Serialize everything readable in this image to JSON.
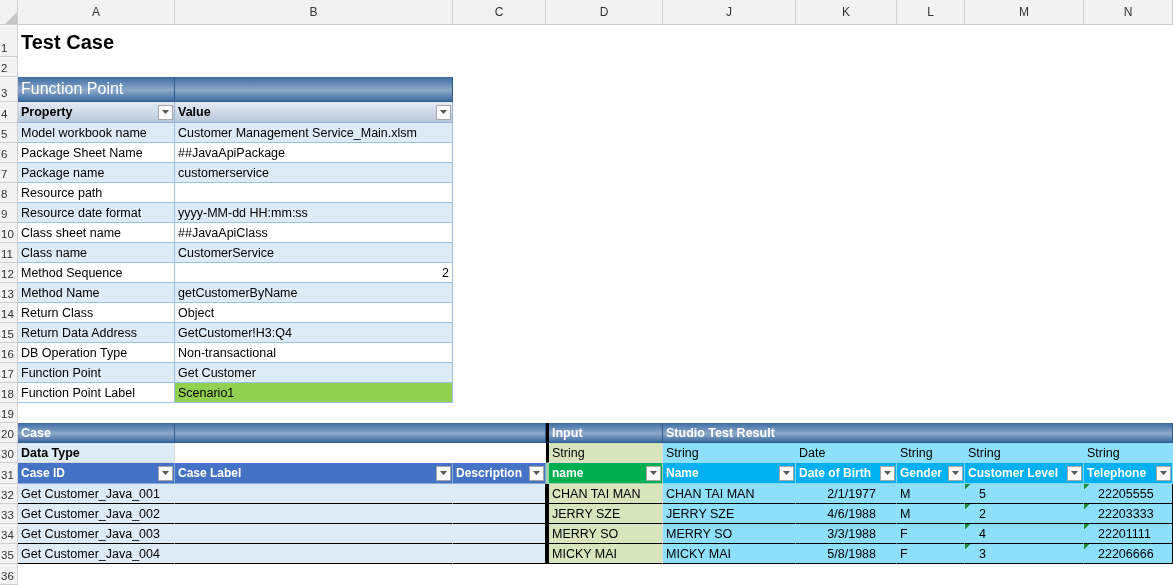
{
  "column_headers": [
    "A",
    "B",
    "C",
    "D",
    "J",
    "K",
    "L",
    "M",
    "N"
  ],
  "row_numbers": [
    "1",
    "2",
    "3",
    "4",
    "5",
    "6",
    "7",
    "8",
    "9",
    "10",
    "11",
    "12",
    "13",
    "14",
    "15",
    "16",
    "17",
    "18",
    "19",
    "20",
    "30",
    "31",
    "32",
    "33",
    "34",
    "35",
    "36"
  ],
  "title": "Test Case",
  "function_point": {
    "title": "Function Point",
    "columns": [
      "Property",
      "Value"
    ],
    "properties": [
      {
        "name": "Model workbook name",
        "value": "Customer Management Service_Main.xlsm",
        "kind": "text"
      },
      {
        "name": "Package Sheet Name",
        "value": "##JavaApiPackage",
        "kind": "text"
      },
      {
        "name": "Package name",
        "value": "customerservice",
        "kind": "text"
      },
      {
        "name": "Resource path",
        "kind": "empty"
      },
      {
        "name": "Resource date format",
        "value": "yyyy-MM-dd HH:mm:ss",
        "kind": "text"
      },
      {
        "name": "Class sheet name",
        "value": "##JavaApiClass",
        "kind": "text"
      },
      {
        "name": "Class name",
        "value": "CustomerService",
        "kind": "text"
      },
      {
        "name": "Method Sequence",
        "value": "2",
        "kind": "number"
      },
      {
        "name": "Method Name",
        "value": "getCustomerByName",
        "kind": "text"
      },
      {
        "name": "Return Class",
        "value": "Object",
        "kind": "text"
      },
      {
        "name": "Return Data Address",
        "value": "GetCustomer!H3:Q4",
        "kind": "text"
      },
      {
        "name": "DB Operation Type",
        "value": "Non-transactional",
        "kind": "text"
      },
      {
        "name": "Function Point",
        "value": "Get Customer",
        "kind": "text"
      },
      {
        "name": "Function Point Label",
        "value": "Scenario1",
        "kind": "highlight"
      }
    ]
  },
  "case_section": {
    "title": "Case",
    "input_title": "Input",
    "result_title": "Studio Test Result",
    "data_type_label": "Data Type",
    "columns": [
      {
        "label": "Case ID",
        "kind": "case"
      },
      {
        "label": "Case Label",
        "kind": "case"
      },
      {
        "label": "Description",
        "kind": "case"
      },
      {
        "label": "name",
        "kind": "input",
        "data_type": "String"
      },
      {
        "label": "Name",
        "kind": "result",
        "data_type": "String"
      },
      {
        "label": "Date of Birth",
        "kind": "result",
        "data_type": "Date"
      },
      {
        "label": "Gender",
        "kind": "result",
        "data_type": "String"
      },
      {
        "label": "Customer Level",
        "kind": "result",
        "data_type": "String"
      },
      {
        "label": "Telephone",
        "kind": "result",
        "data_type": "String"
      }
    ],
    "rows": [
      {
        "cells": [
          {
            "value": "Get Customer_Java_001",
            "kind": "text"
          },
          {
            "kind": "empty"
          },
          {
            "kind": "empty"
          },
          {
            "value": "CHAN TAI MAN",
            "kind": "text"
          },
          {
            "value": "CHAN TAI MAN",
            "kind": "text"
          },
          {
            "value": "2/1/1977",
            "kind": "date"
          },
          {
            "value": "M",
            "kind": "text"
          },
          {
            "value": "5",
            "kind": "number_as_text"
          },
          {
            "value": "22205555",
            "kind": "number_as_text"
          }
        ]
      },
      {
        "cells": [
          {
            "value": "Get Customer_Java_002",
            "kind": "text"
          },
          {
            "kind": "empty"
          },
          {
            "kind": "empty"
          },
          {
            "value": "JERRY SZE",
            "kind": "text"
          },
          {
            "value": "JERRY SZE",
            "kind": "text"
          },
          {
            "value": "4/6/1988",
            "kind": "date"
          },
          {
            "value": "M",
            "kind": "text"
          },
          {
            "value": "2",
            "kind": "number_as_text"
          },
          {
            "value": "22203333",
            "kind": "number_as_text"
          }
        ]
      },
      {
        "cells": [
          {
            "value": "Get Customer_Java_003",
            "kind": "text"
          },
          {
            "kind": "empty"
          },
          {
            "kind": "empty"
          },
          {
            "value": "MERRY SO",
            "kind": "text"
          },
          {
            "value": "MERRY SO",
            "kind": "text"
          },
          {
            "value": "3/3/1988",
            "kind": "date"
          },
          {
            "value": "F",
            "kind": "text"
          },
          {
            "value": "4",
            "kind": "number_as_text"
          },
          {
            "value": "22201111",
            "kind": "number_as_text"
          }
        ]
      },
      {
        "cells": [
          {
            "value": "Get Customer_Java_004",
            "kind": "text"
          },
          {
            "kind": "empty"
          },
          {
            "kind": "empty"
          },
          {
            "value": "MICKY MAI",
            "kind": "text"
          },
          {
            "value": "MICKY MAI",
            "kind": "text"
          },
          {
            "value": "5/8/1988",
            "kind": "date"
          },
          {
            "value": "F",
            "kind": "text"
          },
          {
            "value": "3",
            "kind": "number_as_text"
          },
          {
            "value": "22206666",
            "kind": "number_as_text"
          }
        ]
      }
    ]
  }
}
